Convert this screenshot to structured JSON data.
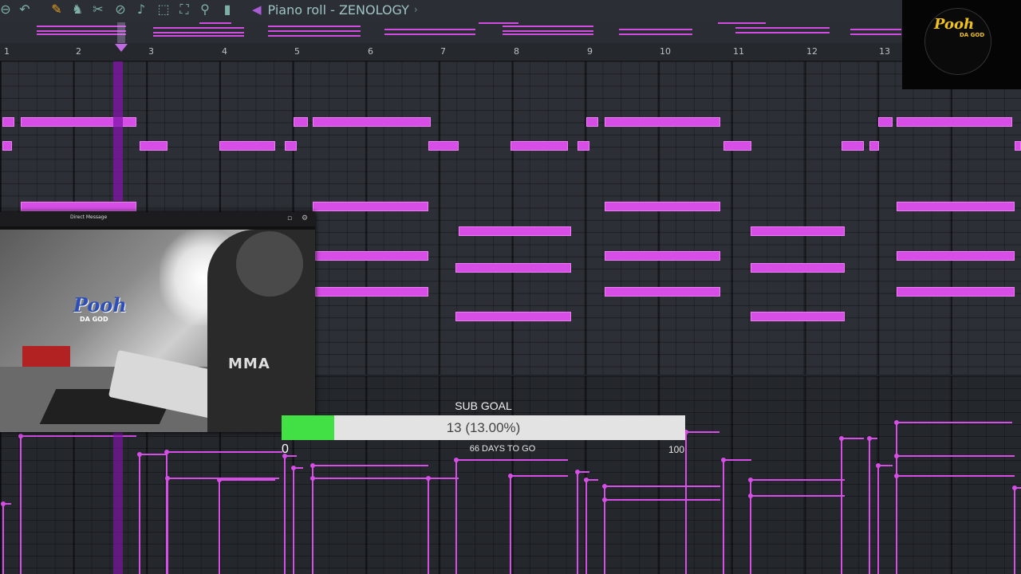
{
  "window": {
    "title": "Piano roll - ZENOLOGY"
  },
  "toolbar": {
    "icons": [
      "menu-icon",
      "undo-icon",
      "draw-pencil-icon",
      "paint-icon",
      "slice-icon",
      "delete-icon",
      "mute-icon",
      "select-icon",
      "zoom-fit-icon",
      "zoom-icon",
      "playback-icon"
    ]
  },
  "ruler": {
    "bars": [
      "1",
      "2",
      "3",
      "4",
      "5",
      "6",
      "7",
      "8",
      "9",
      "10",
      "11",
      "12",
      "13"
    ]
  },
  "stream_logo": {
    "text": "Pooh",
    "sub": "DA GOD"
  },
  "webcam": {
    "title": "Direct Message",
    "logo_text": "Pooh",
    "logo_sub": "DA GOD",
    "shirt_text": "MMA"
  },
  "sub_goal": {
    "label": "SUB GOAL",
    "progress_text": "13 (13.00%)",
    "progress_fraction": 0.13,
    "min": "0",
    "max": "100",
    "days_text": "66 DAYS TO GO"
  },
  "colors": {
    "note": "#d64ee6",
    "progress": "#43e045",
    "accent": "#a85cd6"
  }
}
